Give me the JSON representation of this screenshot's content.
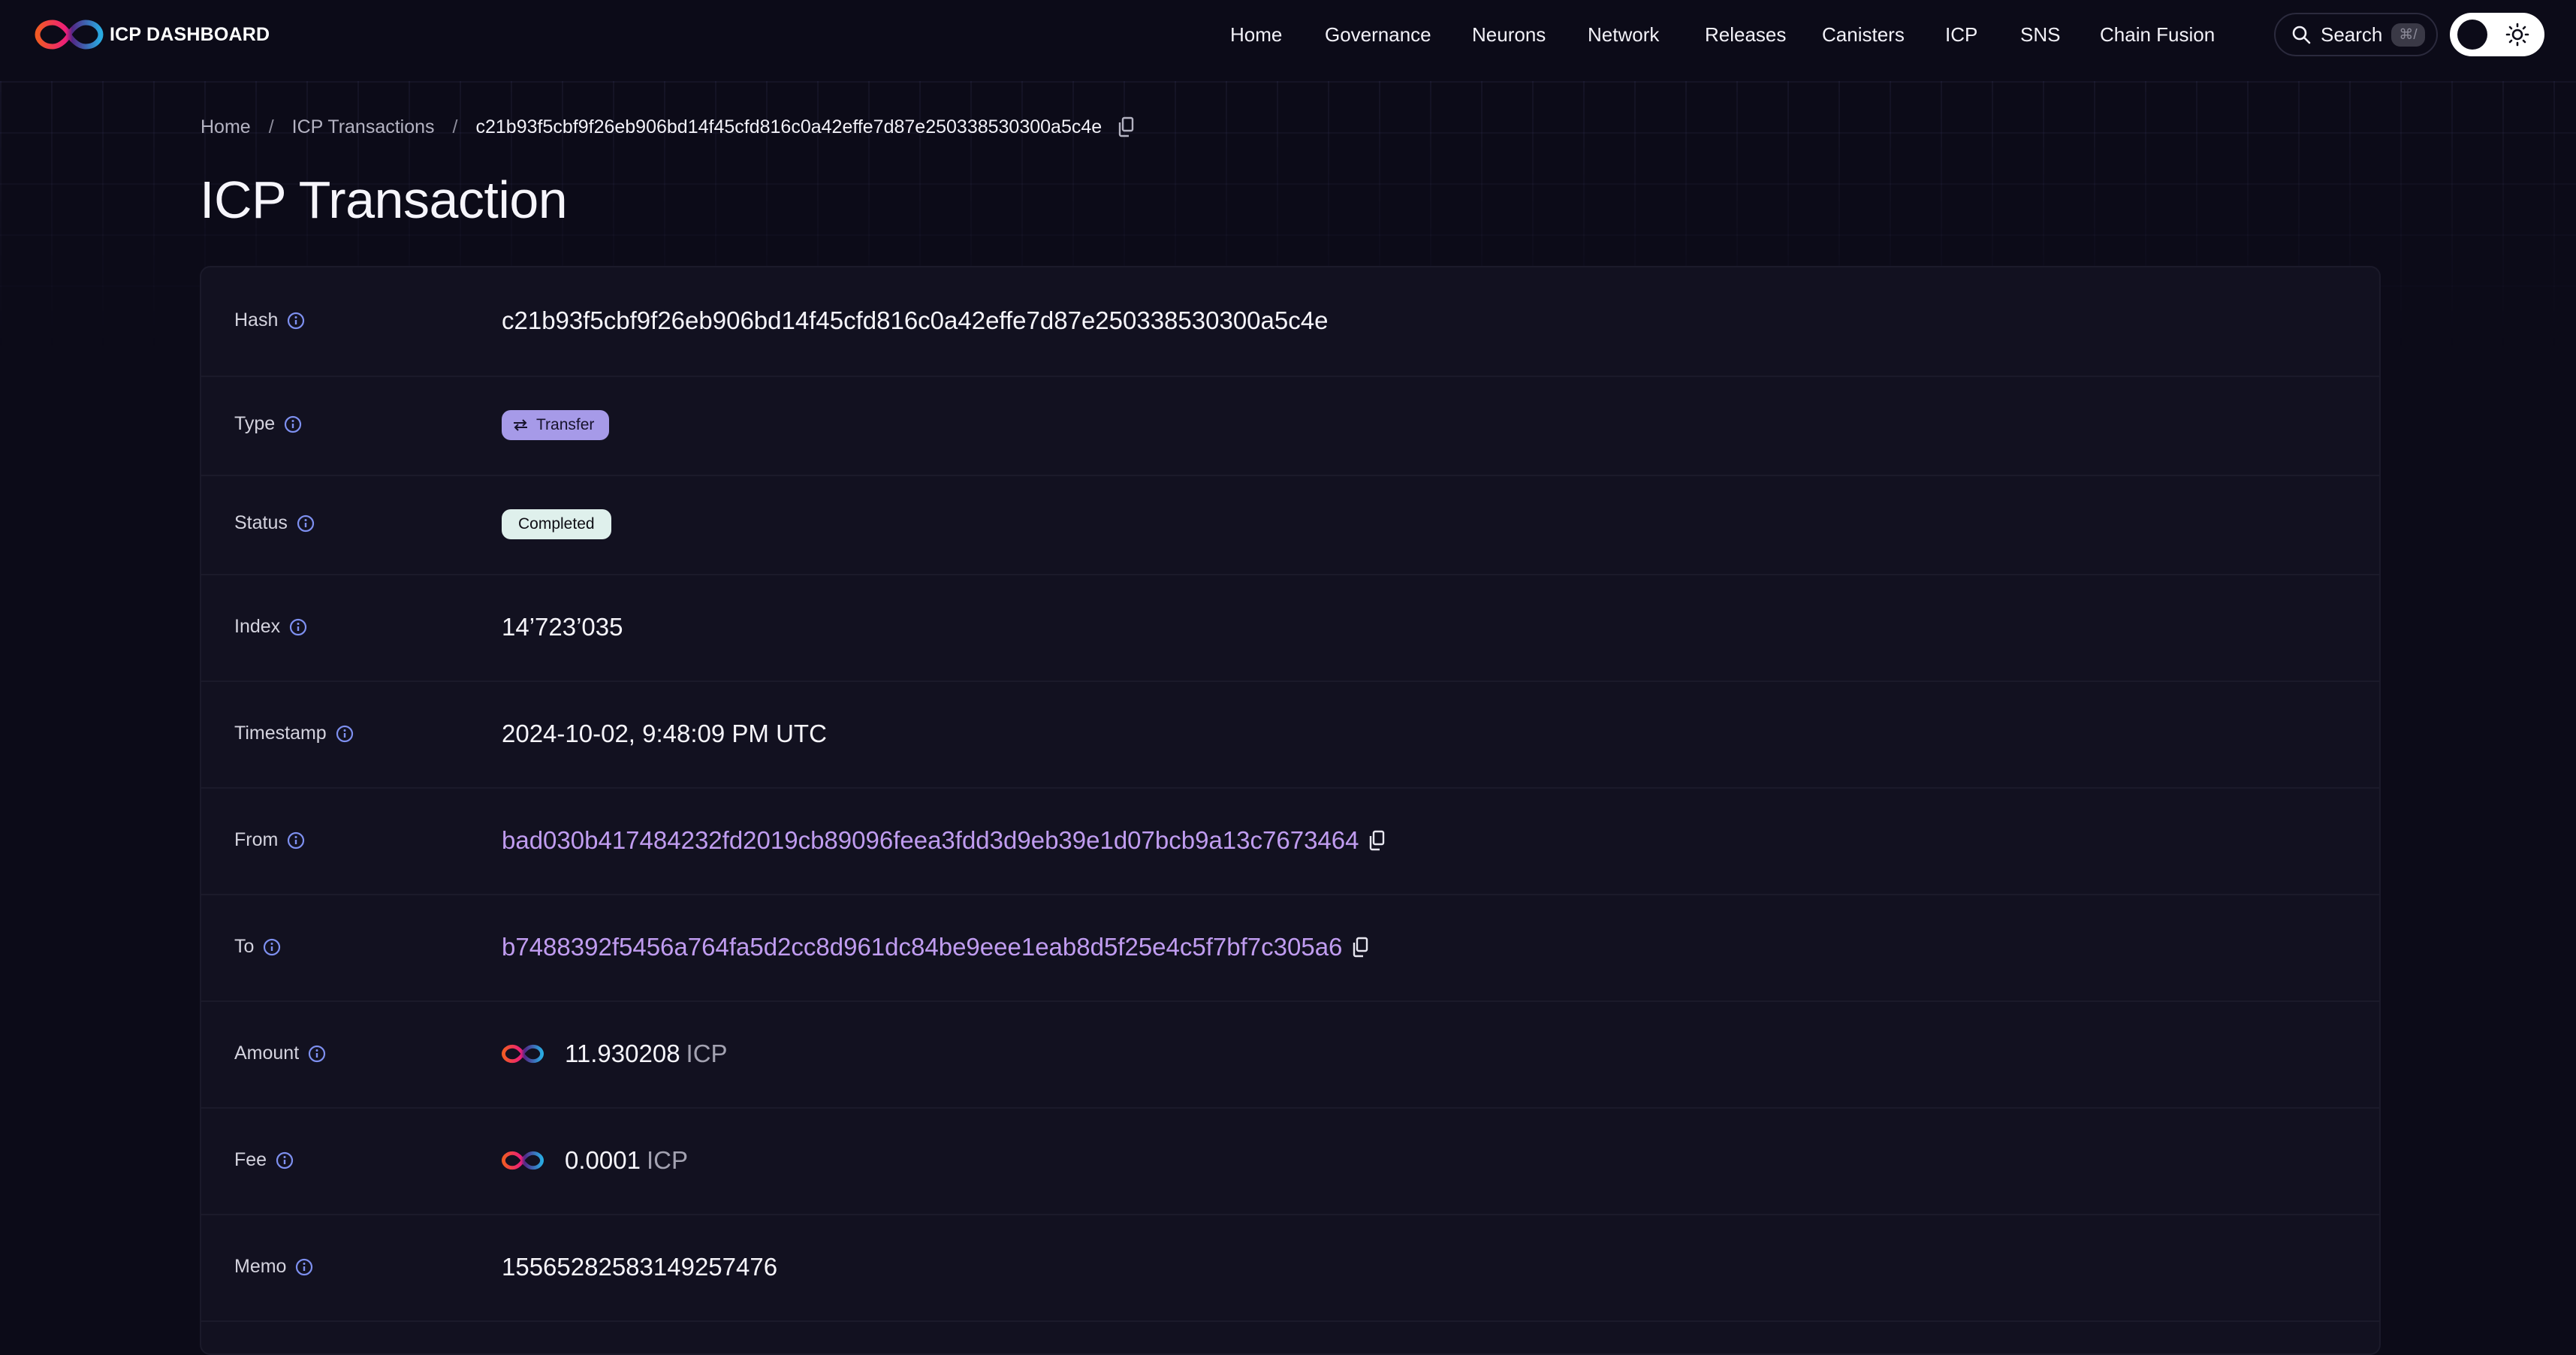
{
  "header": {
    "logo_text": "ICP DASHBOARD",
    "nav": [
      "Home",
      "Governance",
      "Neurons",
      "Network",
      "Releases",
      "Canisters",
      "ICP",
      "SNS",
      "Chain Fusion"
    ],
    "search_label": "Search",
    "search_shortcut": "⌘/"
  },
  "breadcrumb": {
    "home": "Home",
    "section": "ICP Transactions",
    "current": "c21b93f5cbf9f26eb906bd14f45cfd816c0a42effe7d87e250338530300a5c4e"
  },
  "page_title": "ICP Transaction",
  "details": {
    "hash": {
      "label": "Hash",
      "value": "c21b93f5cbf9f26eb906bd14f45cfd816c0a42effe7d87e250338530300a5c4e"
    },
    "type": {
      "label": "Type",
      "value": "Transfer"
    },
    "status": {
      "label": "Status",
      "value": "Completed"
    },
    "index": {
      "label": "Index",
      "value": "14’723’035"
    },
    "timestamp": {
      "label": "Timestamp",
      "value": "2024-10-02, 9:48:09 PM UTC"
    },
    "from": {
      "label": "From",
      "value": "bad030b417484232fd2019cb89096feea3fdd3d9eb39e1d07bcb9a13c7673464"
    },
    "to": {
      "label": "To",
      "value": "b7488392f5456a764fa5d2cc8d961dc84be9eee1eab8d5f25e4c5f7bf7c305a6"
    },
    "amount": {
      "label": "Amount",
      "value": "11.930208",
      "unit": "ICP"
    },
    "fee": {
      "label": "Fee",
      "value": "0.0001",
      "unit": "ICP"
    },
    "memo": {
      "label": "Memo",
      "value": "15565282583149257476"
    }
  },
  "colors": {
    "background": "#0c0b18",
    "card": "#121120",
    "link": "#c09cf0",
    "type_badge": "#a69ae8",
    "status_badge": "#dff0ec",
    "info_icon": "#7e90f0"
  },
  "icons": [
    "icp-logo-icon",
    "search-icon",
    "sun-icon",
    "copy-icon",
    "info-icon",
    "transfer-arrows-icon",
    "icp-token-icon"
  ]
}
